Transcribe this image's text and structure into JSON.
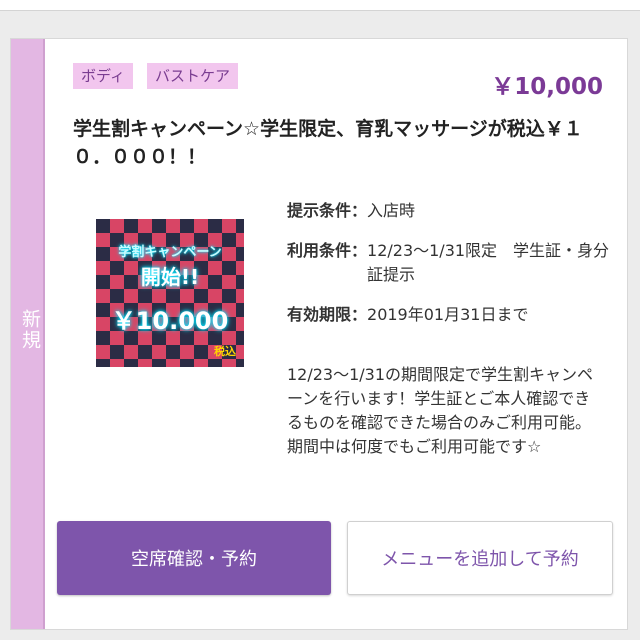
{
  "side_tab": {
    "label": "新規"
  },
  "tags": [
    "ボディ",
    "バストケア"
  ],
  "price": "￥10,000",
  "title": "学生割キャンペーン☆学生限定、育乳マッサージが税込￥１０．０００！！",
  "thumbnail": {
    "line1": "学割キャンペーン",
    "line2": "開始!!",
    "line3": "￥10.000",
    "tax": "税込"
  },
  "conditions": [
    {
      "label": "提示条件：",
      "value": "入店時"
    },
    {
      "label": "利用条件：",
      "value": "12/23〜1/31限定　学生証・身分証提示"
    },
    {
      "label": "有効期限：",
      "value": "2019年01月31日まで"
    }
  ],
  "description": "12/23〜1/31の期間限定で学生割キャンペーンを行います！学生証とご本人確認できるものを確認できた場合のみご利用可能。期間中は何度でもご利用可能です☆",
  "buttons": {
    "check_reserve": "空席確認・予約",
    "add_menu_reserve": "メニューを追加して予約"
  },
  "colors": {
    "accent": "#7e55ab",
    "tag_bg": "#f2c6ee",
    "side_tab_bg": "#e3b7e3"
  }
}
